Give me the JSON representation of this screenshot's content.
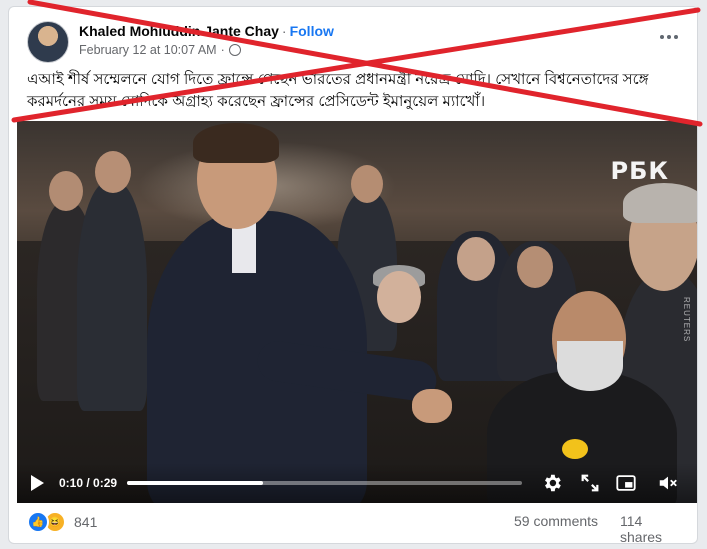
{
  "post": {
    "author": "Khaled Mohiuddin Jante Chay",
    "separator": "·",
    "follow_label": "Follow",
    "timestamp": "February 12 at 10:07 AM",
    "timestamp_separator": "·",
    "text": "এআই শীর্ষ সম্মেলনে যোগ দিতে ফ্রান্সে গেছেন ভারতের প্রধানমন্ত্রী নরেন্দ্র মোদি। সেখানে বিশ্বনেতাদের সঙ্গে করমর্দনের সময় মোদিকে অগ্রাহ্য করেছেন ফ্রান্সের প্রেসিডেন্ট ইমানুয়েল ম্যাখোঁ।"
  },
  "video": {
    "logo": "РБК",
    "watermark": "REUTERS",
    "current_time": "0:10",
    "duration": "0:29",
    "time_separator": " / ",
    "progress_fraction": 0.345
  },
  "engagement": {
    "reaction_count": "841",
    "comments": "59 comments",
    "shares": "114 shares"
  },
  "icons": {
    "more": "more-options-icon",
    "privacy": "globe-icon",
    "play": "play-icon",
    "settings": "gear-icon",
    "fullscreen": "fullscreen-icon",
    "pip": "picture-in-picture-icon",
    "volume": "volume-muted-icon",
    "like": "like-reaction-icon",
    "haha": "haha-reaction-icon"
  },
  "colors": {
    "brand": "#1877f2",
    "cross": "#e0242c"
  }
}
